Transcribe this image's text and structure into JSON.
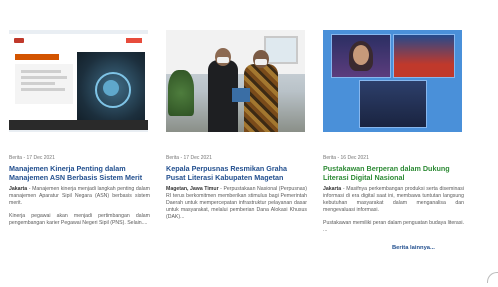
{
  "news": [
    {
      "meta": "Berita - 17 Dec 2021",
      "title": "Manajemen Kinerja Penting dalam Manajemen ASN Berbasis Sistem Merit",
      "location": "Jakarta",
      "paragraph1": " - Manajemen kinerja menjadi langkah penting dalam manajemen Aparatur Sipil Negara (ASN) berbasis sistem merit.",
      "paragraph2": "Kinerja pegawai akan menjadi pertimbangan dalam pengembangan karier Pegawai Negeri Sipil (PNS). Selain....",
      "title_color": "#23508f"
    },
    {
      "meta": "Berita - 17 Dec 2021",
      "title": "Kepala Perpusnas Resmikan Graha Pusat Literasi Kabupaten Magetan",
      "location": "Magetan, Jawa Timur",
      "paragraph1": " - Perpustakaan Nasional (Perpusnas) RI terus berkomitmen memberikan stimulus bagi Pemerintah Daerah untuk mempercepatan infrastruktur pelayanan dasar untuk masyarakat, melalui pemberian Dana Alokasi Khusus (DAK)...",
      "paragraph2": "",
      "title_color": "#23508f"
    },
    {
      "meta": "Berita - 16 Dec 2021",
      "title": "Pustakawan Berperan dalam Dukung Literasi Digital Nasional",
      "location": "Jakarta",
      "paragraph1": " - Masifnya perkembangan produksi serta diseminasi informasi di era digital saat ini, membawa tuntutan langsung kebutuhan masyarakat dalam menganalisa dan mengevaluasi informasi.",
      "paragraph2": "Pustakawan memiliki peran dalam penguatan budaya literasi. ...",
      "title_color": "#2e8b36"
    }
  ],
  "more_link": "Berita lainnya..."
}
